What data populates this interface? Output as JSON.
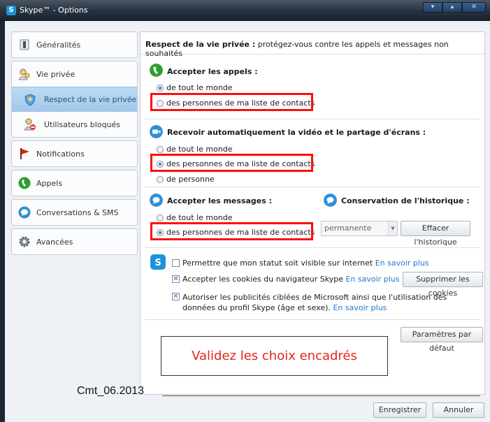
{
  "window": {
    "title": "Skype™ - Options",
    "logo": "S"
  },
  "sidebar": {
    "items": [
      {
        "label": "Généralités",
        "icon": "settings-switch-icon"
      },
      {
        "label": "Vie privée",
        "icon": "privacy-user-icon"
      },
      {
        "label": "Respect de la vie privée",
        "icon": "privacy-shield-icon",
        "selected": true
      },
      {
        "label": "Utilisateurs bloqués",
        "icon": "blocked-user-icon"
      },
      {
        "label": "Notifications",
        "icon": "flag-icon"
      },
      {
        "label": "Appels",
        "icon": "phone-icon"
      },
      {
        "label": "Conversations & SMS",
        "icon": "chat-icon"
      },
      {
        "label": "Avancées",
        "icon": "gear-icon"
      }
    ]
  },
  "header": {
    "title": "Respect de la vie privée :",
    "subtitle": " protégez-vous contre les appels et messages non souhaités"
  },
  "calls": {
    "title": "Accepter les appels :",
    "options": [
      "de tout le monde",
      "des personnes de ma liste de contacts"
    ],
    "selected": 0
  },
  "video": {
    "title": "Recevoir automatiquement la vidéo et le partage d'écrans :",
    "options": [
      "de tout le monde",
      "des personnes de ma liste de contacts",
      "de personne"
    ],
    "selected": 1
  },
  "messages": {
    "title": "Accepter les messages :",
    "options": [
      "de tout le monde",
      "des personnes de ma liste de contacts"
    ],
    "selected": 1
  },
  "history": {
    "title": "Conservation de l'historique :",
    "select_value": "permanente",
    "clear_label": "Effacer l'historique"
  },
  "privacy_settings": {
    "status_visible": {
      "label": "Permettre que mon statut soit visible sur internet",
      "link": "En savoir plus",
      "checked": false
    },
    "cookies": {
      "label": "Accepter les cookies du navigateur Skype",
      "link": "En savoir plus",
      "checked": true,
      "button": "Supprimer les cookies"
    },
    "ads": {
      "label": "Autoriser les publicités ciblées de Microsoft ainsi que l'utilisation des données du profil Skype (âge et sexe).",
      "link": "En savoir plus",
      "checked": true
    }
  },
  "defaults_label": "Paramètres par défaut",
  "annotation": "Validez les choix encadrés",
  "watermark": "Cmt_06.2013",
  "footer": {
    "save": "Enregistrer",
    "cancel": "Annuler"
  },
  "colors": {
    "highlight_red": "#ff0d0d",
    "link_blue": "#1f78c8",
    "skype_blue": "#1f93d8",
    "call_green": "#2f9e31"
  }
}
